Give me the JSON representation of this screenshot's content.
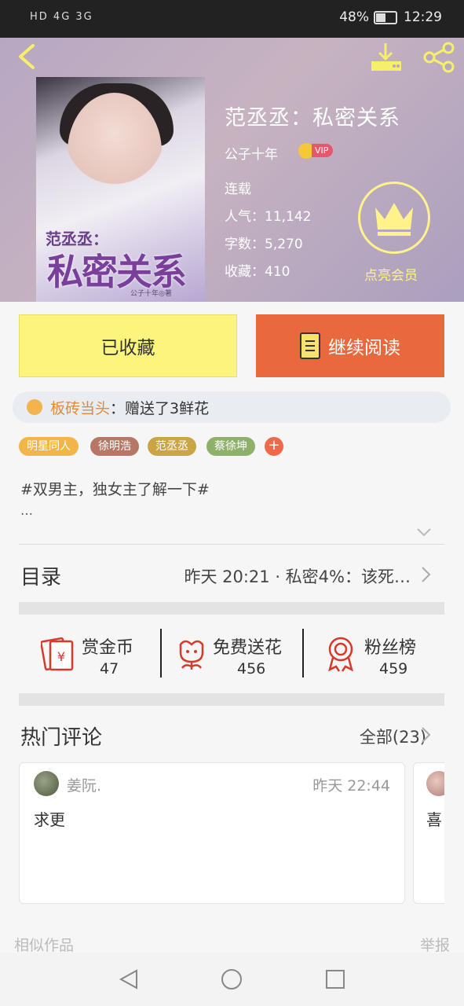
{
  "status_bar": {
    "network": "HD 4G 3G",
    "battery": "48%",
    "time": "12:29"
  },
  "book": {
    "title": "范丞丞：私密关系",
    "author": "公子十年",
    "vip_badge": "VIP",
    "status": "连载",
    "popularity": "人气：11,142",
    "word_count": "字数：5,270",
    "favorites": "收藏：410",
    "cover_title_small": "范丞丞：",
    "cover_title_big": "私密关系",
    "cover_author": "公子十年◎著"
  },
  "membership": {
    "label": "点亮会员"
  },
  "actions": {
    "favorited_label": "已收藏",
    "continue_label": "继续阅读"
  },
  "gift_notice": {
    "user": "板砖当头",
    "text": "：赠送了3鲜花"
  },
  "tags": [
    "明星同人",
    "徐明浩",
    "范丞丞",
    "蔡徐坤"
  ],
  "tag_add": "+",
  "description": {
    "text": "#双男主，独女主了解一下#",
    "ellipsis": "…"
  },
  "toc": {
    "label": "目录",
    "latest": "昨天 20:21 · 私密4%：该死…"
  },
  "metrics": [
    {
      "label": "赏金币",
      "value": "47"
    },
    {
      "label": "免费送花",
      "value": "456"
    },
    {
      "label": "粉丝榜",
      "value": "459"
    }
  ],
  "comments": {
    "label": "热门评论",
    "all": "全部(23)",
    "items": [
      {
        "user": "姜阮.",
        "time": "昨天 22:44",
        "text": "求更"
      },
      {
        "text": "喜"
      }
    ]
  },
  "footer": {
    "similar": "相似作品",
    "report": "举报"
  },
  "colors": {
    "accent_orange": "#e9693f",
    "fav_yellow": "#fbf57d",
    "vip_gold": "#fff28a"
  }
}
